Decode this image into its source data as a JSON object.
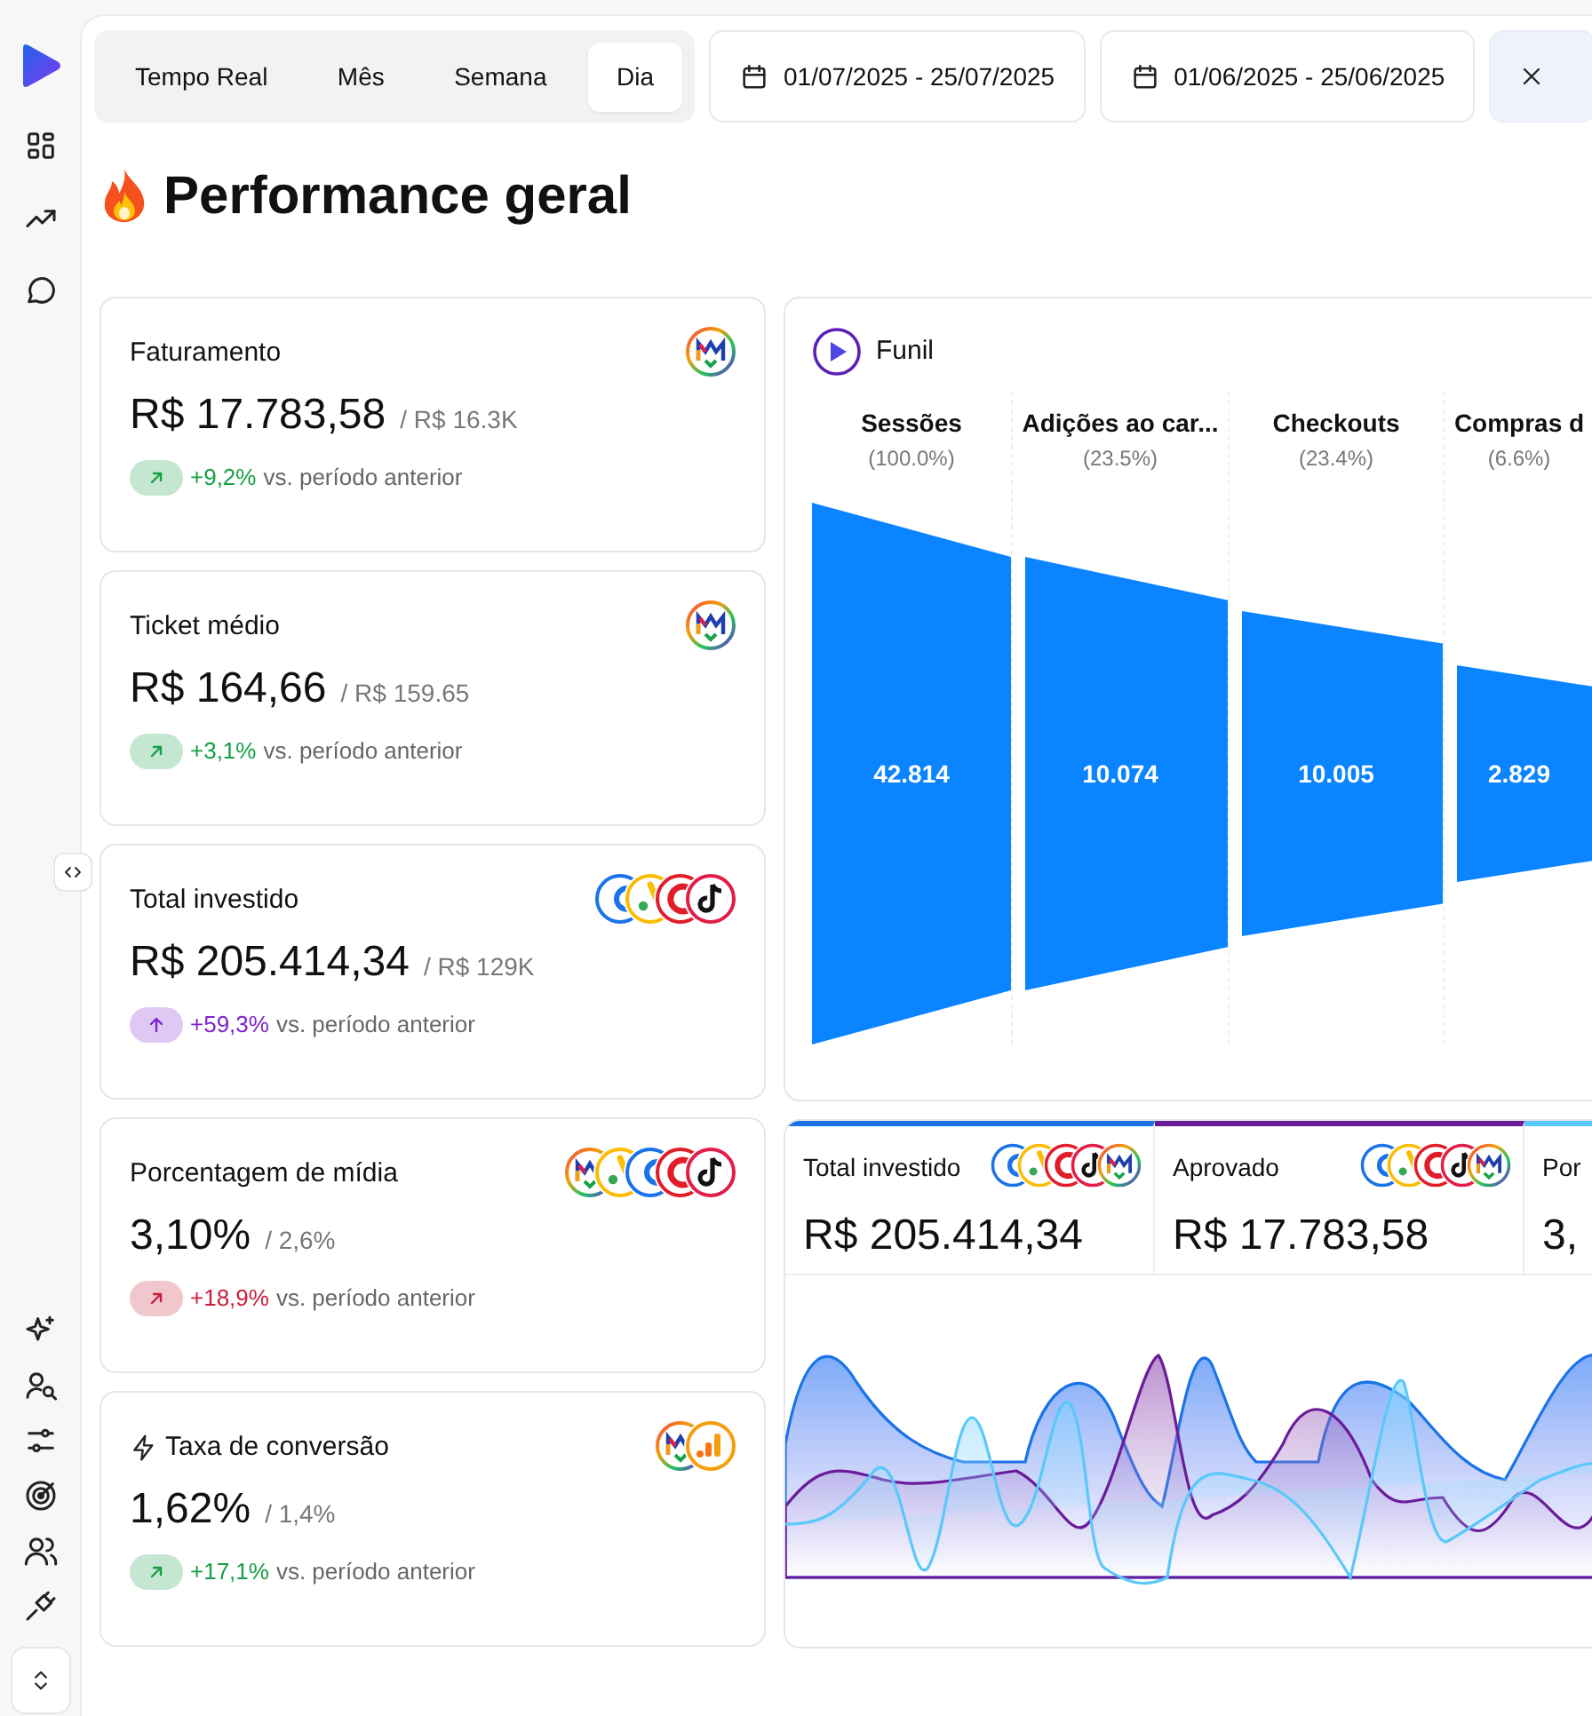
{
  "period_tabs": [
    {
      "label": "Tempo Real",
      "selected": false
    },
    {
      "label": "Mês",
      "selected": false
    },
    {
      "label": "Semana",
      "selected": false
    },
    {
      "label": "Dia",
      "selected": true
    }
  ],
  "date_ranges": [
    "01/07/2025 - 25/07/2025",
    "01/06/2025 - 25/06/2025"
  ],
  "title": "Performance geral",
  "metrics": [
    {
      "title": "Faturamento",
      "bolt": false,
      "value": "R$ 17.783,58",
      "previous": "/ R$ 16.3K",
      "change": "+9,2%",
      "color": "#15a045",
      "kind": "diagonal",
      "comparison": "vs. período anterior",
      "logos": [
        {
          "kind": "m"
        }
      ]
    },
    {
      "title": "Ticket médio",
      "bolt": false,
      "value": "R$ 164,66",
      "previous": "/ R$ 159.65",
      "change": "+3,1%",
      "color": "#15a045",
      "kind": "diagonal",
      "comparison": "vs. período anterior",
      "logos": [
        {
          "kind": "m"
        }
      ]
    },
    {
      "title": "Total investido",
      "bolt": false,
      "value": "R$ 205.414,34",
      "previous": "/ R$ 129K",
      "change": "+59,3%",
      "color": "#7e22ce",
      "kind": "up",
      "comparison": "vs. período anterior",
      "logos": [
        {
          "kind": "loop"
        },
        {
          "kind": "triangle"
        },
        {
          "kind": "red"
        },
        {
          "kind": "note"
        }
      ]
    },
    {
      "title": "Porcentagem de mídia",
      "bolt": false,
      "value": "3,10%",
      "previous": "/ 2,6%",
      "change": "+18,9%",
      "color": "#c81e3a",
      "kind": "diagonal",
      "comparison": "vs. período anterior",
      "logos": [
        {
          "kind": "m"
        },
        {
          "kind": "triangle"
        },
        {
          "kind": "loop"
        },
        {
          "kind": "red"
        },
        {
          "kind": "note"
        }
      ]
    },
    {
      "title": "Taxa de conversão",
      "bolt": true,
      "value": "1,62%",
      "previous": "/ 1,4%",
      "change": "+17,1%",
      "color": "#15a045",
      "kind": "diagonal",
      "comparison": "vs. período anterior",
      "logos": [
        {
          "kind": "m"
        },
        {
          "kind": "bars"
        }
      ]
    }
  ],
  "funnel": {
    "title": "Funil",
    "stages": [
      {
        "label": "Sessões",
        "share": "(100.0%)",
        "value": "42.814"
      },
      {
        "label": "Adições ao car...",
        "share": "(23.5%)",
        "value": "10.074"
      },
      {
        "label": "Checkouts",
        "share": "(23.4%)",
        "value": "10.005"
      },
      {
        "label": "Compras d",
        "share": "(6.6%)",
        "value": "2.829"
      }
    ]
  },
  "summary": {
    "tabs": [
      {
        "label": "Total investido",
        "value": "R$ 205.414,34",
        "color": "#1a73e8",
        "logos": [
          {
            "kind": "loop"
          },
          {
            "kind": "triangle"
          },
          {
            "kind": "red"
          },
          {
            "kind": "note"
          },
          {
            "kind": "m"
          }
        ]
      },
      {
        "label": "Aprovado",
        "value": "R$ 17.783,58",
        "color": "#6a1b9a",
        "logos": [
          {
            "kind": "loop"
          },
          {
            "kind": "triangle"
          },
          {
            "kind": "red"
          },
          {
            "kind": "note"
          },
          {
            "kind": "m"
          }
        ]
      },
      {
        "label": "Por",
        "value": "3,",
        "color": "#5ac8fa"
      }
    ]
  }
}
